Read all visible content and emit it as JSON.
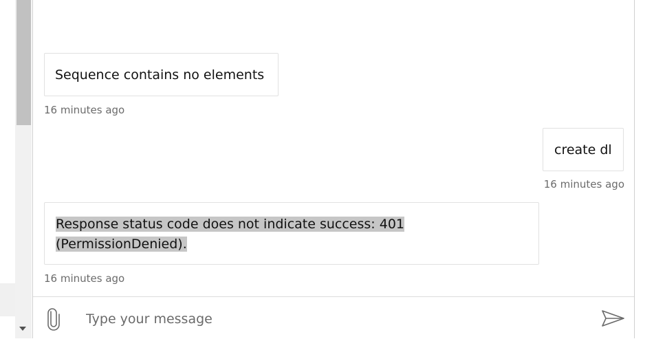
{
  "messages": [
    {
      "text": "Sequence contains no elements",
      "time": "16 minutes ago",
      "from": "bot"
    },
    {
      "text": "create dl",
      "time": "16 minutes ago",
      "from": "user"
    },
    {
      "line1": "Response status code does not indicate success: 401",
      "line2": "(PermissionDenied).",
      "time": "16 minutes ago",
      "from": "bot",
      "highlighted": true
    }
  ],
  "composer": {
    "placeholder": "Type your message",
    "attach_icon": "paperclip-icon",
    "send_icon": "send-icon"
  },
  "colors": {
    "highlight": "#c6c6c6",
    "timestamp": "#6b6b6b",
    "bubble_border": "#e1e1e1"
  }
}
